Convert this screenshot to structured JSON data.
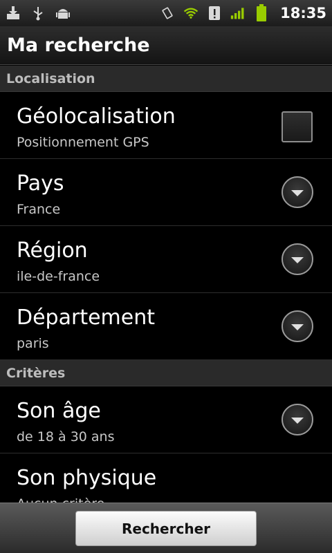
{
  "status_bar": {
    "time": "18:35",
    "left_icons": [
      "download-icon",
      "usb-icon",
      "android-debug-icon"
    ],
    "right_icons": [
      "vibrate-icon",
      "wifi-icon",
      "alert-icon",
      "signal-icon",
      "battery-icon"
    ],
    "accent_color": "#99cc00"
  },
  "header": {
    "title": "Ma recherche"
  },
  "sections": {
    "localisation": {
      "header": "Localisation",
      "items": {
        "geolocalisation": {
          "title": "Géolocalisation",
          "summary": "Positionnement GPS",
          "checked": false
        },
        "pays": {
          "title": "Pays",
          "summary": "France"
        },
        "region": {
          "title": "Région",
          "summary": "ile-de-france"
        },
        "departement": {
          "title": "Département",
          "summary": "paris"
        }
      }
    },
    "criteres": {
      "header": "Critères",
      "items": {
        "age": {
          "title": "Son âge",
          "summary": "de 18 à 30 ans"
        },
        "physique": {
          "title": "Son physique",
          "summary": "Aucun critère"
        }
      }
    }
  },
  "footer": {
    "search_label": "Rechercher"
  }
}
